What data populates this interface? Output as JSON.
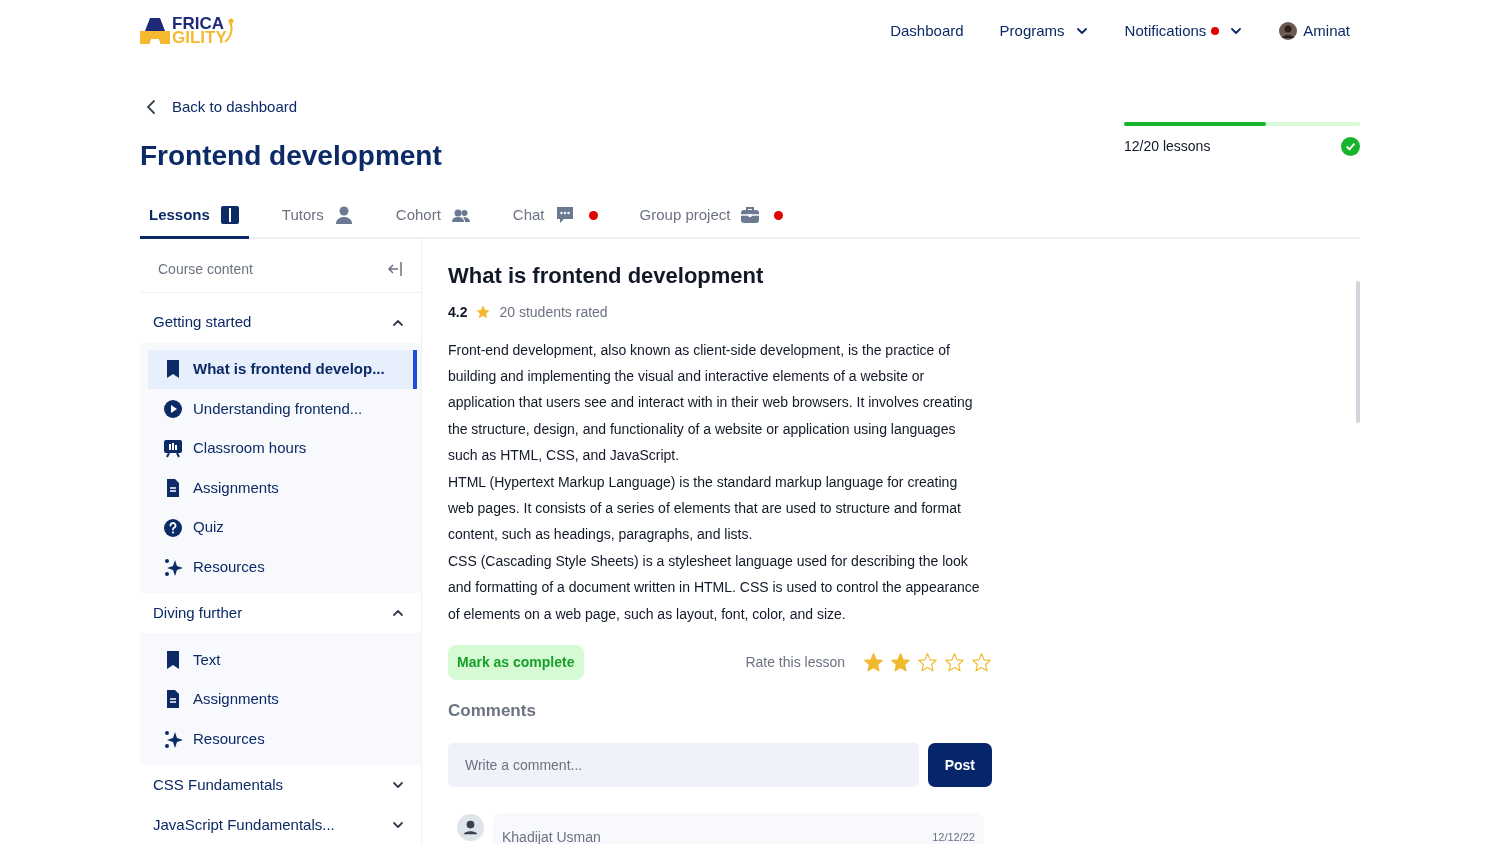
{
  "logo": {
    "line_1": "FRICA",
    "line_2": "GILITY"
  },
  "nav": [
    {
      "label": "Dashboard",
      "dropdown": false,
      "dot": false,
      "kind": "link"
    },
    {
      "label": "Programs",
      "dropdown": true,
      "dot": false,
      "kind": "link"
    },
    {
      "label": "Notifications",
      "dropdown": true,
      "dot": true,
      "kind": "link"
    },
    {
      "label": "Aminat",
      "dropdown": false,
      "dot": false,
      "kind": "user"
    }
  ],
  "back_link": "Back to dashboard",
  "page_title": "Frontend development",
  "progress": {
    "level": 0.6,
    "label": "12/20 lessons",
    "complete": true
  },
  "tabs": [
    {
      "label": "Lessons",
      "selected": true,
      "dot": false
    },
    {
      "label": "Tutors",
      "selected": false,
      "dot": false
    },
    {
      "label": "Cohort",
      "selected": false,
      "dot": false
    },
    {
      "label": "Chat",
      "selected": false,
      "dot": true
    },
    {
      "label": "Group project",
      "selected": false,
      "dot": true
    }
  ],
  "sidebar": {
    "title": "Course content",
    "sections": [
      {
        "title": "Getting started",
        "expanded": true,
        "items": [
          {
            "label": "What is frontend develop...",
            "kind": "text",
            "selected": true
          },
          {
            "label": "Understanding frontend...",
            "kind": "video",
            "selected": false
          },
          {
            "label": "Classroom hours",
            "kind": "class",
            "selected": false
          },
          {
            "label": "Assignments",
            "kind": "assignment",
            "selected": false
          },
          {
            "label": "Quiz",
            "kind": "quiz",
            "selected": false
          },
          {
            "label": "Resources",
            "kind": "resource",
            "selected": false
          }
        ]
      },
      {
        "title": "Diving further",
        "expanded": true,
        "items": [
          {
            "label": "Text",
            "kind": "text",
            "selected": false
          },
          {
            "label": "Assignments",
            "kind": "assignment",
            "selected": false
          },
          {
            "label": "Resources",
            "kind": "resource",
            "selected": false
          }
        ]
      },
      {
        "title": "CSS Fundamentals",
        "expanded": false
      },
      {
        "title": "JavaScript Fundamentals...",
        "expanded": false
      }
    ]
  },
  "lesson": {
    "title": "What is frontend development",
    "rating": "4.2",
    "rated_count": "20 students rated",
    "paragraphs": [
      "Front-end development, also known as client-side development, is the practice of building and implementing the visual and interactive elements of a website or application that users see and interact with in their web browsers. It involves creating the structure, design, and functionality of a website or application using languages such as HTML, CSS, and JavaScript.",
      "HTML (Hypertext Markup Language) is the standard markup language for creating web pages. It consists of a series of elements that are used to structure and format content, such as headings, paragraphs, and lists.",
      "CSS (Cascading Style Sheets) is a stylesheet language used for describing the look and formatting of a document written in HTML. CSS is used to control the appearance of elements on a web page, such as layout, font, color, and size."
    ],
    "complete_button": "Mark as complete",
    "rate_label": "Rate this lesson",
    "stars": 2
  },
  "comments": {
    "title": "Comments",
    "placeholder": "Write a comment...",
    "post_button": "Post",
    "items": [
      {
        "author": "Khadijat Usman",
        "date": "12/12/22"
      }
    ]
  }
}
